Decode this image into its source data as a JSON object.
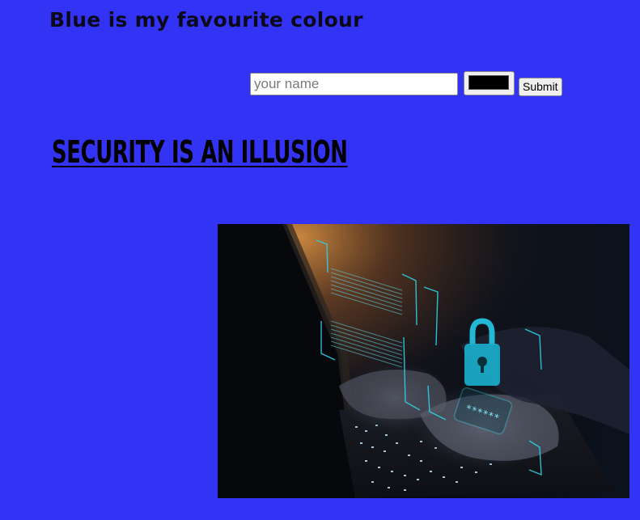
{
  "header": {
    "title": "Blue is my favourite colour"
  },
  "form": {
    "name_placeholder": "your name",
    "name_value": "",
    "color_value": "#000000",
    "submit_label": "Submit"
  },
  "article": {
    "headline": "SECURITY IS AN ILLUSION"
  },
  "image": {
    "password_mask": "******",
    "icon": "padlock-icon"
  },
  "colors": {
    "background": "#3333f5",
    "accent": "#1fb8d0"
  }
}
